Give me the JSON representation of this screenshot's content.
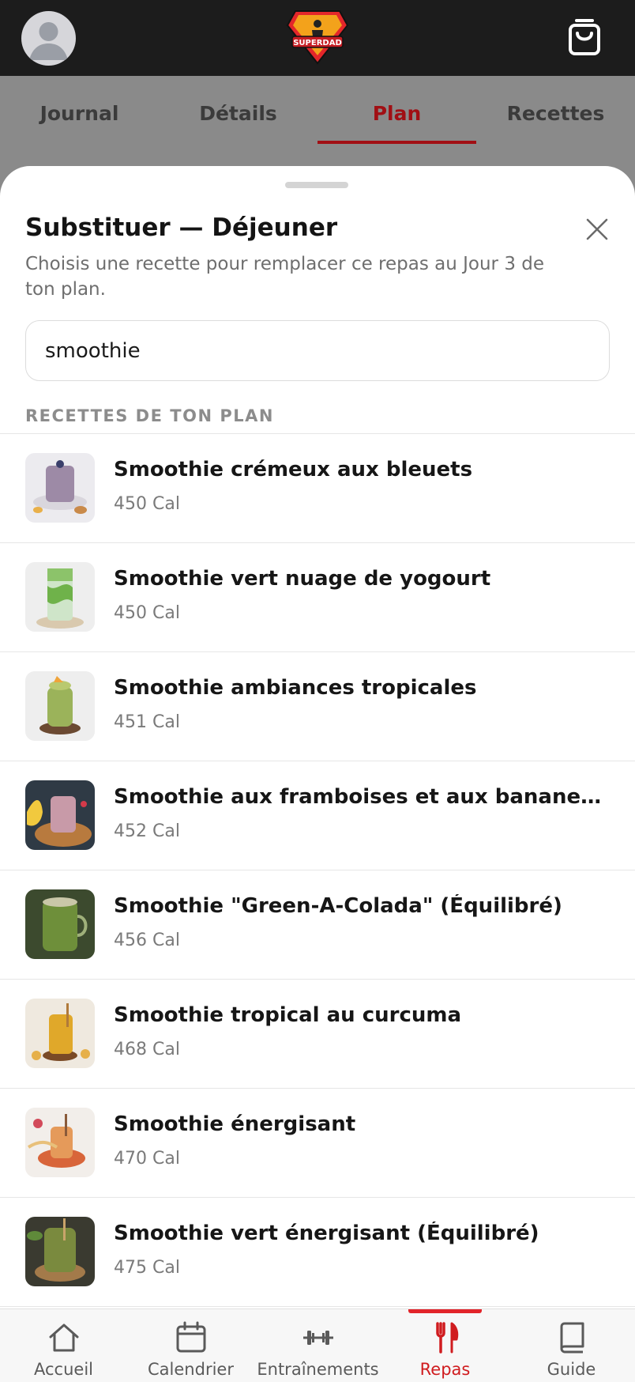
{
  "app": {
    "logo_text": "SUPERDAD"
  },
  "header": {
    "avatar_icon": "user-avatar-icon",
    "cart_icon": "shopping-bag-icon"
  },
  "tabs": [
    {
      "label": "Journal",
      "active": false
    },
    {
      "label": "Détails",
      "active": false
    },
    {
      "label": "Plan",
      "active": true
    },
    {
      "label": "Recettes",
      "active": false
    }
  ],
  "sheet": {
    "title": "Substituer — Déjeuner",
    "subtitle": "Choisis une recette pour remplacer ce repas au Jour 3 de ton plan.",
    "search_value": "smoothie",
    "section_label": "RECETTES DE TON PLAN",
    "recipes": [
      {
        "name": "Smoothie crémeux aux bleuets",
        "calories": "450 Cal"
      },
      {
        "name": "Smoothie vert nuage de yogourt",
        "calories": "450 Cal"
      },
      {
        "name": "Smoothie ambiances tropicales",
        "calories": "451 Cal"
      },
      {
        "name": "Smoothie aux framboises et aux bananes (Éq...",
        "calories": "452 Cal"
      },
      {
        "name": "Smoothie \"Green-A-Colada\" (Équilibré)",
        "calories": "456 Cal"
      },
      {
        "name": "Smoothie tropical au curcuma",
        "calories": "468 Cal"
      },
      {
        "name": "Smoothie énergisant",
        "calories": "470 Cal"
      },
      {
        "name": "Smoothie vert énergisant (Équilibré)",
        "calories": "475 Cal"
      }
    ]
  },
  "bottom_nav": [
    {
      "label": "Accueil",
      "icon": "home-icon",
      "active": false
    },
    {
      "label": "Calendrier",
      "icon": "calendar-icon",
      "active": false
    },
    {
      "label": "Entraînements",
      "icon": "dumbbell-icon",
      "active": false
    },
    {
      "label": "Repas",
      "icon": "fork-knife-icon",
      "active": true
    },
    {
      "label": "Guide",
      "icon": "book-icon",
      "active": false
    }
  ],
  "colors": {
    "accent": "#d01c1f",
    "tab_active": "#a10f14",
    "topbar": "#1c1c1c"
  }
}
